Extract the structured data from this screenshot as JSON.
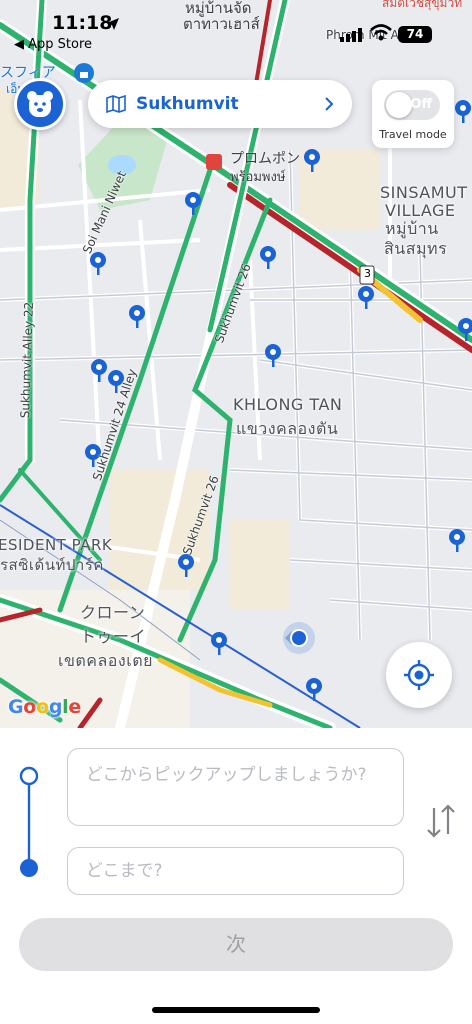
{
  "status_bar": {
    "time": "11:18",
    "back_label": "◀ App Store",
    "battery": "74"
  },
  "map": {
    "labels": {
      "top_thai": "หมู่บ้านจัด",
      "top_thai2": "ตาทาวเฮาส์",
      "top_right_red": "สมิติเวชสุขุมวิท",
      "phrom_mit_alley": "Phrom Mit Alley",
      "sufia": "スフィア",
      "em_district": "เอ็มดี",
      "phrom_phong_jp": "プロムポン",
      "phrom_phong_th": "พร้อมพงษ์",
      "sinsamut_1": "SINSAMUT",
      "sinsamut_2": "VILLAGE",
      "sinsamut_th1": "หมู่บ้าน",
      "sinsamut_th2": "สินสมุทร",
      "soi_mani": "Soi Mani Niwet",
      "sukhumvit_26_top": "Sukhumvit 26",
      "sukhumvit_22": "Sukhumvit Alley 22",
      "sukhumvit_24": "Sukhumvit 24 Alley",
      "sukhumvit_26_bottom": "Sukhumvit 26",
      "khlong_tan": "KHLONG TAN",
      "khlong_tan_th": "แขวงคลองตัน",
      "resident_park": "ESIDENT PARK",
      "resident_park_th": "รสซิเด้นท์ปาร์ค",
      "khlong_toei_jp1": "クローン",
      "khlong_toei_jp2": "トゥーイ",
      "khlong_toei_th": "เขตคลองเตย",
      "route_shield": "3"
    },
    "attribution": "Google"
  },
  "header": {
    "location_label": "Sukhumvit",
    "travel_toggle_state": "Off",
    "travel_mode_label": "Travel mode"
  },
  "booking": {
    "pickup_placeholder": "どこからピックアップしましょうか?",
    "dropoff_placeholder": "どこまで?",
    "next_label": "次"
  },
  "colors": {
    "accent": "#1b63d4",
    "road_green": "#2db36e",
    "road_red": "#b5252b",
    "road_yellow": "#f2c230"
  }
}
